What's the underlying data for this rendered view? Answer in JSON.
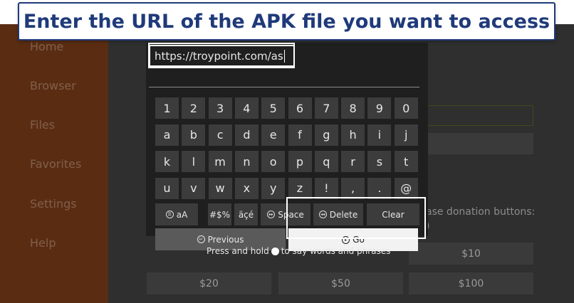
{
  "banner": {
    "text": "Enter the URL of the APK file you want to access"
  },
  "sidebar": {
    "items": [
      "Home",
      "Browser",
      "Files",
      "Favorites",
      "Settings",
      "Help"
    ]
  },
  "background": {
    "donation_text": "ase donation buttons:",
    "donation_paren": ")",
    "amounts": [
      "$10",
      "$20",
      "$50",
      "$100"
    ]
  },
  "keyboard": {
    "url_value": "https://troypoint.com/as",
    "rows": [
      [
        "1",
        "2",
        "3",
        "4",
        "5",
        "6",
        "7",
        "8",
        "9",
        "0"
      ],
      [
        "a",
        "b",
        "c",
        "d",
        "e",
        "f",
        "g",
        "h",
        "i",
        "j"
      ],
      [
        "k",
        "l",
        "m",
        "n",
        "o",
        "p",
        "q",
        "r",
        "s",
        "t"
      ],
      [
        "u",
        "v",
        "w",
        "x",
        "y",
        "z",
        "!",
        ",",
        ".",
        "@"
      ]
    ],
    "function_keys": {
      "case": "aA",
      "symbols": "#$%",
      "accents": "äçé",
      "space": "Space",
      "delete": "Delete",
      "clear": "Clear"
    },
    "previous_label": "Previous",
    "go_label": "Go"
  },
  "hint": {
    "before": "Press and hold",
    "after": "to say words and phrases"
  }
}
